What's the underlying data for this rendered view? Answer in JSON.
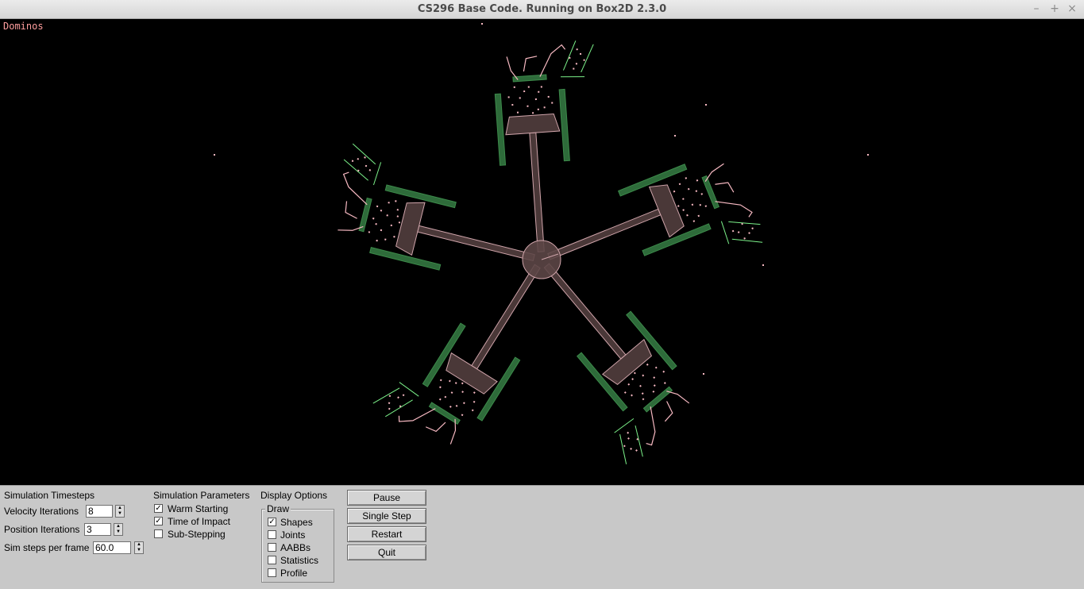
{
  "window": {
    "title": "CS296 Base Code. Running on Box2D 2.3.0",
    "controls": [
      "minimize-icon",
      "maximize-icon",
      "close-icon"
    ]
  },
  "viewport": {
    "scene_label": "Dominos",
    "background": "#000000",
    "colors": {
      "static_green": "#2e6b3a",
      "dynamic_pink": "#f7b9c2",
      "ghost_green": "#7cf28a"
    }
  },
  "panel": {
    "timesteps": {
      "heading": "Simulation Timesteps",
      "velocity_label": "Velocity Iterations",
      "velocity_value": "8",
      "position_label": "Position Iterations",
      "position_value": "3",
      "steps_label": "Sim steps per frame",
      "steps_value": "60.0"
    },
    "parameters": {
      "heading": "Simulation Parameters",
      "warm_starting": "Warm Starting",
      "warm_starting_checked": true,
      "toi": "Time of Impact",
      "toi_checked": true,
      "substepping": "Sub-Stepping",
      "substepping_checked": false
    },
    "display": {
      "heading": "Display Options",
      "group": "Draw",
      "shapes": "Shapes",
      "shapes_checked": true,
      "joints": "Joints",
      "joints_checked": false,
      "aabbs": "AABBs",
      "aabbs_checked": false,
      "statistics": "Statistics",
      "statistics_checked": false,
      "profile": "Profile",
      "profile_checked": false
    },
    "buttons": {
      "pause": "Pause",
      "single_step": "Single Step",
      "restart": "Restart",
      "quit": "Quit"
    }
  }
}
